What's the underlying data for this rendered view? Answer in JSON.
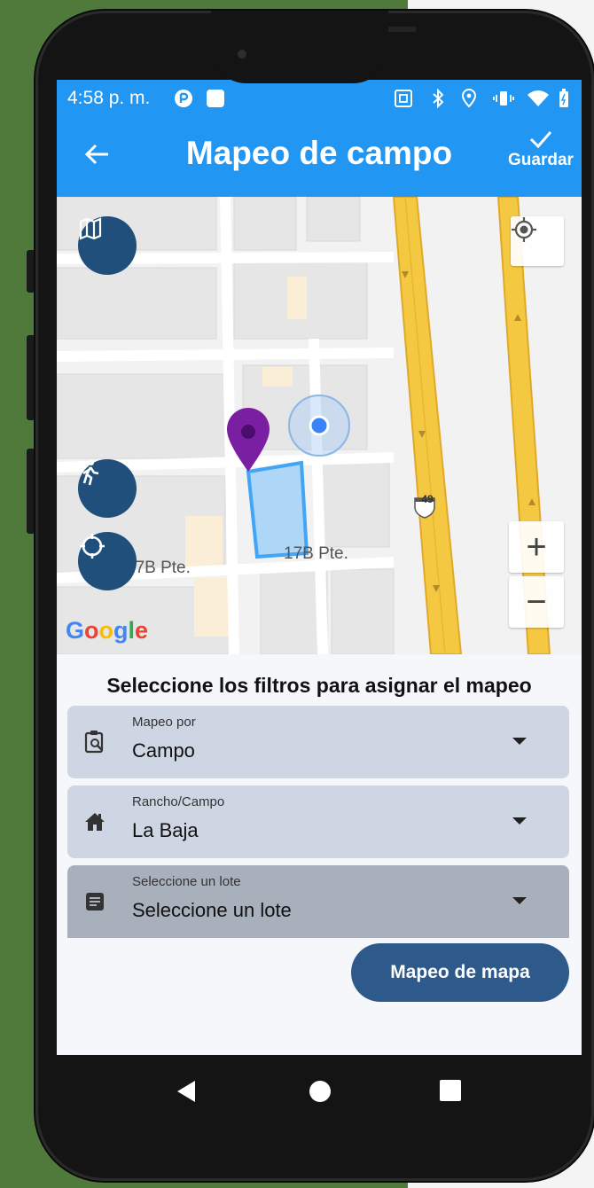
{
  "status": {
    "time": "4:58 p. m."
  },
  "appbar": {
    "title": "Mapeo de campo",
    "save_label": "Guardar"
  },
  "map": {
    "streets": [
      "17B Pte.",
      "17B Pte."
    ],
    "highway_shield": "49",
    "logo": "Google",
    "zoom_in": "+",
    "zoom_out": "−",
    "icons": [
      "map-icon",
      "walk-icon",
      "crosshair-icon",
      "my-location-icon",
      "location-pin-icon",
      "user-location-dot"
    ],
    "colors": {
      "fab": "#1f4f7a",
      "highway": "#f5c842",
      "pin": "#7b1fa2",
      "selection": "#64b5f6"
    }
  },
  "form": {
    "heading": "Seleccione los filtros para asignar el mapeo",
    "fields": [
      {
        "label": "Mapeo por",
        "value": "Campo",
        "icon": "clipboard-search-icon"
      },
      {
        "label": "Rancho/Campo",
        "value": "La Baja",
        "icon": "house-icon"
      },
      {
        "label": "Seleccione un lote",
        "value": "Seleccione un lote",
        "icon": "note-icon"
      }
    ],
    "button": "Mapeo de mapa"
  },
  "colors": {
    "primary": "#2196f3",
    "button": "#2d5a8b",
    "field": "#cfd6e3",
    "field_disabled": "#a8b0bb"
  },
  "navbar": {
    "icons": [
      "back-triangle-icon",
      "home-circle-icon",
      "recents-square-icon"
    ]
  }
}
